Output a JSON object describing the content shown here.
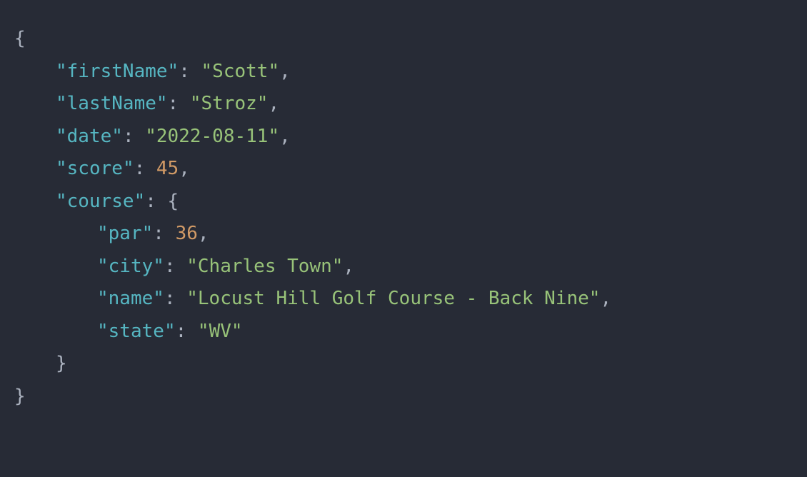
{
  "json": {
    "firstName_key": "firstName",
    "firstName_val": "Scott",
    "lastName_key": "lastName",
    "lastName_val": "Stroz",
    "date_key": "date",
    "date_val": "2022-08-11",
    "score_key": "score",
    "score_val": "45",
    "course_key": "course",
    "par_key": "par",
    "par_val": "36",
    "city_key": "city",
    "city_val": "Charles Town",
    "name_key": "name",
    "name_val": "Locust Hill Golf Course - Back Nine",
    "state_key": "state",
    "state_val": "WV"
  },
  "symbols": {
    "open_brace": "{",
    "close_brace": "}",
    "quote": "\"",
    "colon_space": ": ",
    "comma": ","
  }
}
